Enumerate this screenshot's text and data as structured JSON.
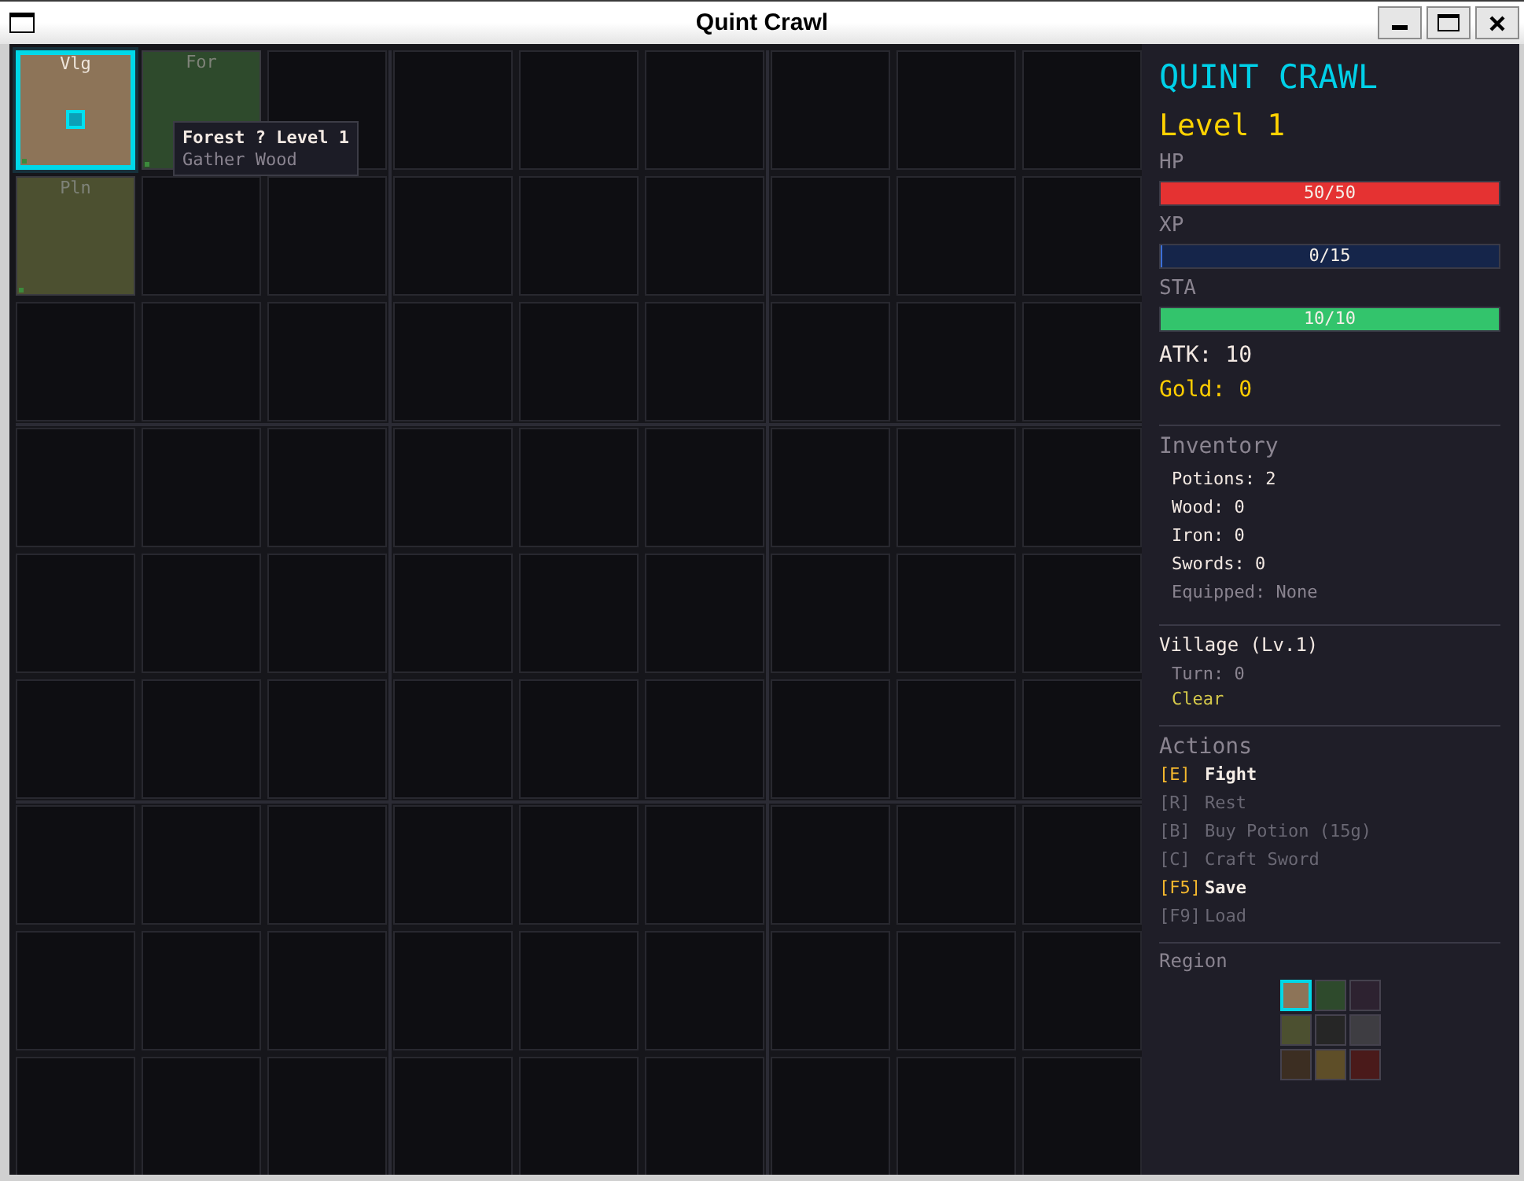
{
  "window": {
    "title": "Quint Crawl"
  },
  "map": {
    "rows": [
      [
        {
          "kind": "village",
          "label": "Vlg",
          "selected": true
        },
        {
          "kind": "forest",
          "label": "For",
          "selected": false
        },
        {
          "kind": "unexplored",
          "selected": false
        },
        {
          "kind": "unexplored",
          "selected": false
        },
        {
          "kind": "unexplored",
          "selected": false
        },
        {
          "kind": "unexplored",
          "selected": false
        },
        {
          "kind": "unexplored",
          "selected": false
        },
        {
          "kind": "unexplored",
          "selected": false
        },
        {
          "kind": "unexplored",
          "selected": false
        }
      ],
      [
        {
          "kind": "plains",
          "label": "Pln",
          "selected": false
        },
        {
          "kind": "unexplored",
          "selected": false
        },
        {
          "kind": "unexplored",
          "selected": false
        },
        {
          "kind": "unexplored",
          "selected": false
        },
        {
          "kind": "unexplored",
          "selected": false
        },
        {
          "kind": "unexplored",
          "selected": false
        },
        {
          "kind": "unexplored",
          "selected": false
        },
        {
          "kind": "unexplored",
          "selected": false
        },
        {
          "kind": "unexplored",
          "selected": false
        }
      ],
      [
        {
          "kind": "unexplored",
          "selected": false
        },
        {
          "kind": "unexplored",
          "selected": false
        },
        {
          "kind": "unexplored",
          "selected": false
        },
        {
          "kind": "unexplored",
          "selected": false
        },
        {
          "kind": "unexplored",
          "selected": false
        },
        {
          "kind": "unexplored",
          "selected": false
        },
        {
          "kind": "unexplored",
          "selected": false
        },
        {
          "kind": "unexplored",
          "selected": false
        },
        {
          "kind": "unexplored",
          "selected": false
        }
      ],
      [
        {
          "kind": "unexplored",
          "selected": false
        },
        {
          "kind": "unexplored",
          "selected": false
        },
        {
          "kind": "unexplored",
          "selected": false
        },
        {
          "kind": "unexplored",
          "selected": false
        },
        {
          "kind": "unexplored",
          "selected": false
        },
        {
          "kind": "unexplored",
          "selected": false
        },
        {
          "kind": "unexplored",
          "selected": false
        },
        {
          "kind": "unexplored",
          "selected": false
        },
        {
          "kind": "unexplored",
          "selected": false
        }
      ],
      [
        {
          "kind": "unexplored",
          "selected": false
        },
        {
          "kind": "unexplored",
          "selected": false
        },
        {
          "kind": "unexplored",
          "selected": false
        },
        {
          "kind": "unexplored",
          "selected": false
        },
        {
          "kind": "unexplored",
          "selected": false
        },
        {
          "kind": "unexplored",
          "selected": false
        },
        {
          "kind": "unexplored",
          "selected": false
        },
        {
          "kind": "unexplored",
          "selected": false
        },
        {
          "kind": "unexplored",
          "selected": false
        }
      ],
      [
        {
          "kind": "unexplored",
          "selected": false
        },
        {
          "kind": "unexplored",
          "selected": false
        },
        {
          "kind": "unexplored",
          "selected": false
        },
        {
          "kind": "unexplored",
          "selected": false
        },
        {
          "kind": "unexplored",
          "selected": false
        },
        {
          "kind": "unexplored",
          "selected": false
        },
        {
          "kind": "unexplored",
          "selected": false
        },
        {
          "kind": "unexplored",
          "selected": false
        },
        {
          "kind": "unexplored",
          "selected": false
        }
      ],
      [
        {
          "kind": "unexplored",
          "selected": false
        },
        {
          "kind": "unexplored",
          "selected": false
        },
        {
          "kind": "unexplored",
          "selected": false
        },
        {
          "kind": "unexplored",
          "selected": false
        },
        {
          "kind": "unexplored",
          "selected": false
        },
        {
          "kind": "unexplored",
          "selected": false
        },
        {
          "kind": "unexplored",
          "selected": false
        },
        {
          "kind": "unexplored",
          "selected": false
        },
        {
          "kind": "unexplored",
          "selected": false
        }
      ],
      [
        {
          "kind": "unexplored",
          "selected": false
        },
        {
          "kind": "unexplored",
          "selected": false
        },
        {
          "kind": "unexplored",
          "selected": false
        },
        {
          "kind": "unexplored",
          "selected": false
        },
        {
          "kind": "unexplored",
          "selected": false
        },
        {
          "kind": "unexplored",
          "selected": false
        },
        {
          "kind": "unexplored",
          "selected": false
        },
        {
          "kind": "unexplored",
          "selected": false
        },
        {
          "kind": "unexplored",
          "selected": false
        }
      ],
      [
        {
          "kind": "unexplored",
          "selected": false
        },
        {
          "kind": "unexplored",
          "selected": false
        },
        {
          "kind": "unexplored",
          "selected": false
        },
        {
          "kind": "unexplored",
          "selected": false
        },
        {
          "kind": "unexplored",
          "selected": false
        },
        {
          "kind": "unexplored",
          "selected": false
        },
        {
          "kind": "unexplored",
          "selected": false
        },
        {
          "kind": "unexplored",
          "selected": false
        },
        {
          "kind": "unexplored",
          "selected": false
        }
      ]
    ],
    "tooltip": {
      "title": "Forest ? Level 1",
      "subtitle": "Gather Wood"
    }
  },
  "sidebar": {
    "title": "QUINT CRAWL",
    "level": "Level 1",
    "bars": [
      {
        "kind": "hp",
        "label": "HP",
        "reading": "50/50",
        "level": 1
      },
      {
        "kind": "xp",
        "label": "XP",
        "reading": "0/15",
        "level": 0
      },
      {
        "kind": "sta",
        "label": "STA",
        "reading": "10/10",
        "level": 1
      }
    ],
    "attack": "ATK: 10",
    "gold": "Gold: 0",
    "inventory": {
      "heading": "Inventory",
      "items": [
        {
          "kind": "count",
          "text": "Potions: 2"
        },
        {
          "kind": "count",
          "text": "Wood: 0"
        },
        {
          "kind": "count",
          "text": "Iron: 0"
        },
        {
          "kind": "count",
          "text": "Swords: 0"
        },
        {
          "kind": "equipment",
          "text": "Equipped: None"
        }
      ]
    },
    "location": {
      "title": "Village (Lv.1)",
      "turn": "Turn: 0",
      "status": "Clear"
    },
    "actions": {
      "heading": "Actions",
      "items": [
        {
          "key": "[E]",
          "label": "Fight",
          "disabled": false
        },
        {
          "key": "[R]",
          "label": "Rest",
          "disabled": true
        },
        {
          "key": "[B]",
          "label": "Buy Potion (15g)",
          "disabled": true
        },
        {
          "key": "[C]",
          "label": "Craft Sword",
          "disabled": true
        },
        {
          "key": "[F5]",
          "label": "Save",
          "disabled": false
        },
        {
          "key": "[F9]",
          "label": "Load",
          "disabled": true
        }
      ]
    },
    "region": {
      "heading": "Region",
      "rows": [
        [
          {
            "color": "#8d7458",
            "selected": true
          },
          {
            "color": "#2e4a2c",
            "selected": false
          },
          {
            "color": "#2d2230",
            "selected": false
          }
        ],
        [
          {
            "color": "#4c5030",
            "selected": false
          },
          {
            "color": "#262626",
            "selected": false
          },
          {
            "color": "#3e3d42",
            "selected": false
          }
        ],
        [
          {
            "color": "#3c2e22",
            "selected": false
          },
          {
            "color": "#5e4e28",
            "selected": false
          },
          {
            "color": "#4a1a1a",
            "selected": false
          }
        ]
      ]
    }
  }
}
